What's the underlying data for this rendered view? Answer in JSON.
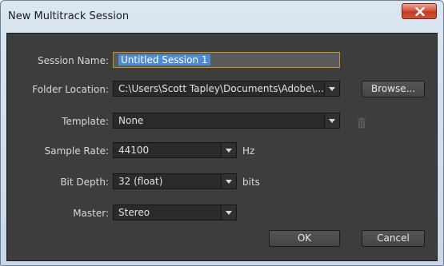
{
  "window": {
    "title": "New Multitrack Session"
  },
  "form": {
    "session_name": {
      "label": "Session Name:",
      "value": "Untitled Session 1"
    },
    "folder_location": {
      "label": "Folder Location:",
      "value": "C:\\Users\\Scott Tapley\\Documents\\Adobe\\..."
    },
    "template": {
      "label": "Template:",
      "value": "None"
    },
    "sample_rate": {
      "label": "Sample Rate:",
      "value": "44100",
      "unit": "Hz"
    },
    "bit_depth": {
      "label": "Bit Depth:",
      "value": "32 (float)",
      "unit": "bits"
    },
    "master": {
      "label": "Master:",
      "value": "Stereo"
    }
  },
  "buttons": {
    "browse": "Browse...",
    "ok": "OK",
    "cancel": "Cancel"
  },
  "icons": {
    "close": "close-icon",
    "dropdown": "chevron-down-icon",
    "delete_template": "trash-icon"
  },
  "colors": {
    "panel_bg": "#3d3d3d",
    "focus_border": "#c99323",
    "selection": "#4d8ccf",
    "close_button": "#c23a22"
  }
}
